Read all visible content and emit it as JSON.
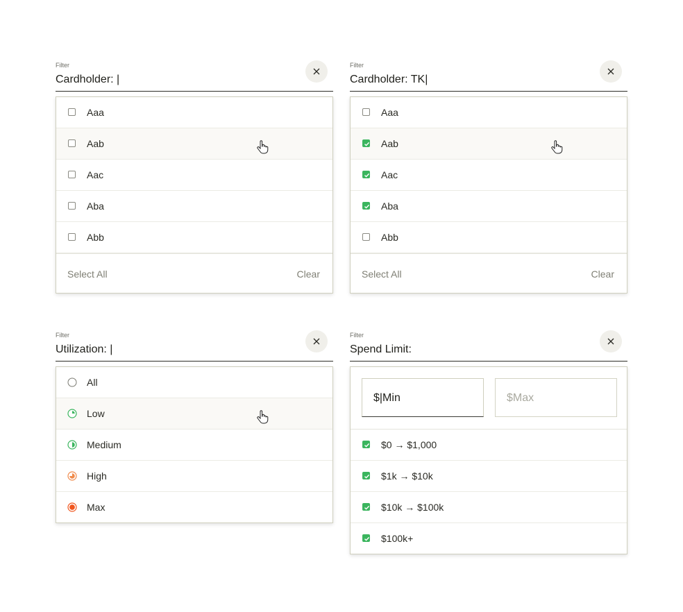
{
  "filters": [
    {
      "label": "Filter",
      "value": "Cardholder: |",
      "items": [
        {
          "label": "Aaa",
          "checked": false
        },
        {
          "label": "Aab",
          "checked": false
        },
        {
          "label": "Aac",
          "checked": false
        },
        {
          "label": "Aba",
          "checked": false
        },
        {
          "label": "Abb",
          "checked": false
        }
      ],
      "select_all": "Select All",
      "clear": "Clear"
    },
    {
      "label": "Filter",
      "value": "Cardholder: TK|",
      "items": [
        {
          "label": "Aaa",
          "checked": false
        },
        {
          "label": "Aab",
          "checked": true
        },
        {
          "label": "Aac",
          "checked": true
        },
        {
          "label": "Aba",
          "checked": true
        },
        {
          "label": "Abb",
          "checked": false
        }
      ],
      "select_all": "Select All",
      "clear": "Clear"
    },
    {
      "label": "Filter",
      "value": "Utilization: |",
      "items": [
        {
          "label": "All",
          "icon": "empty-circle-icon"
        },
        {
          "label": "Low",
          "icon": "quarter-pie-icon"
        },
        {
          "label": "Medium",
          "icon": "half-pie-icon"
        },
        {
          "label": "High",
          "icon": "three-quarter-pie-icon"
        },
        {
          "label": "Max",
          "icon": "full-circle-icon"
        }
      ]
    },
    {
      "label": "Filter",
      "value": "Spend Limit:",
      "min_value": "$|Min",
      "max_placeholder": "$Max",
      "items": [
        {
          "label": "$0 → $1,000",
          "checked": true
        },
        {
          "label": "$1k → $10k",
          "checked": true
        },
        {
          "label": "$10k → $100k",
          "checked": true
        },
        {
          "label": "$100k+",
          "checked": true
        }
      ]
    }
  ],
  "colors": {
    "check_green": "#3bb55e",
    "low_green": "#3bb55e",
    "high_orange": "#f08a4b",
    "max_orange": "#f0561d"
  }
}
